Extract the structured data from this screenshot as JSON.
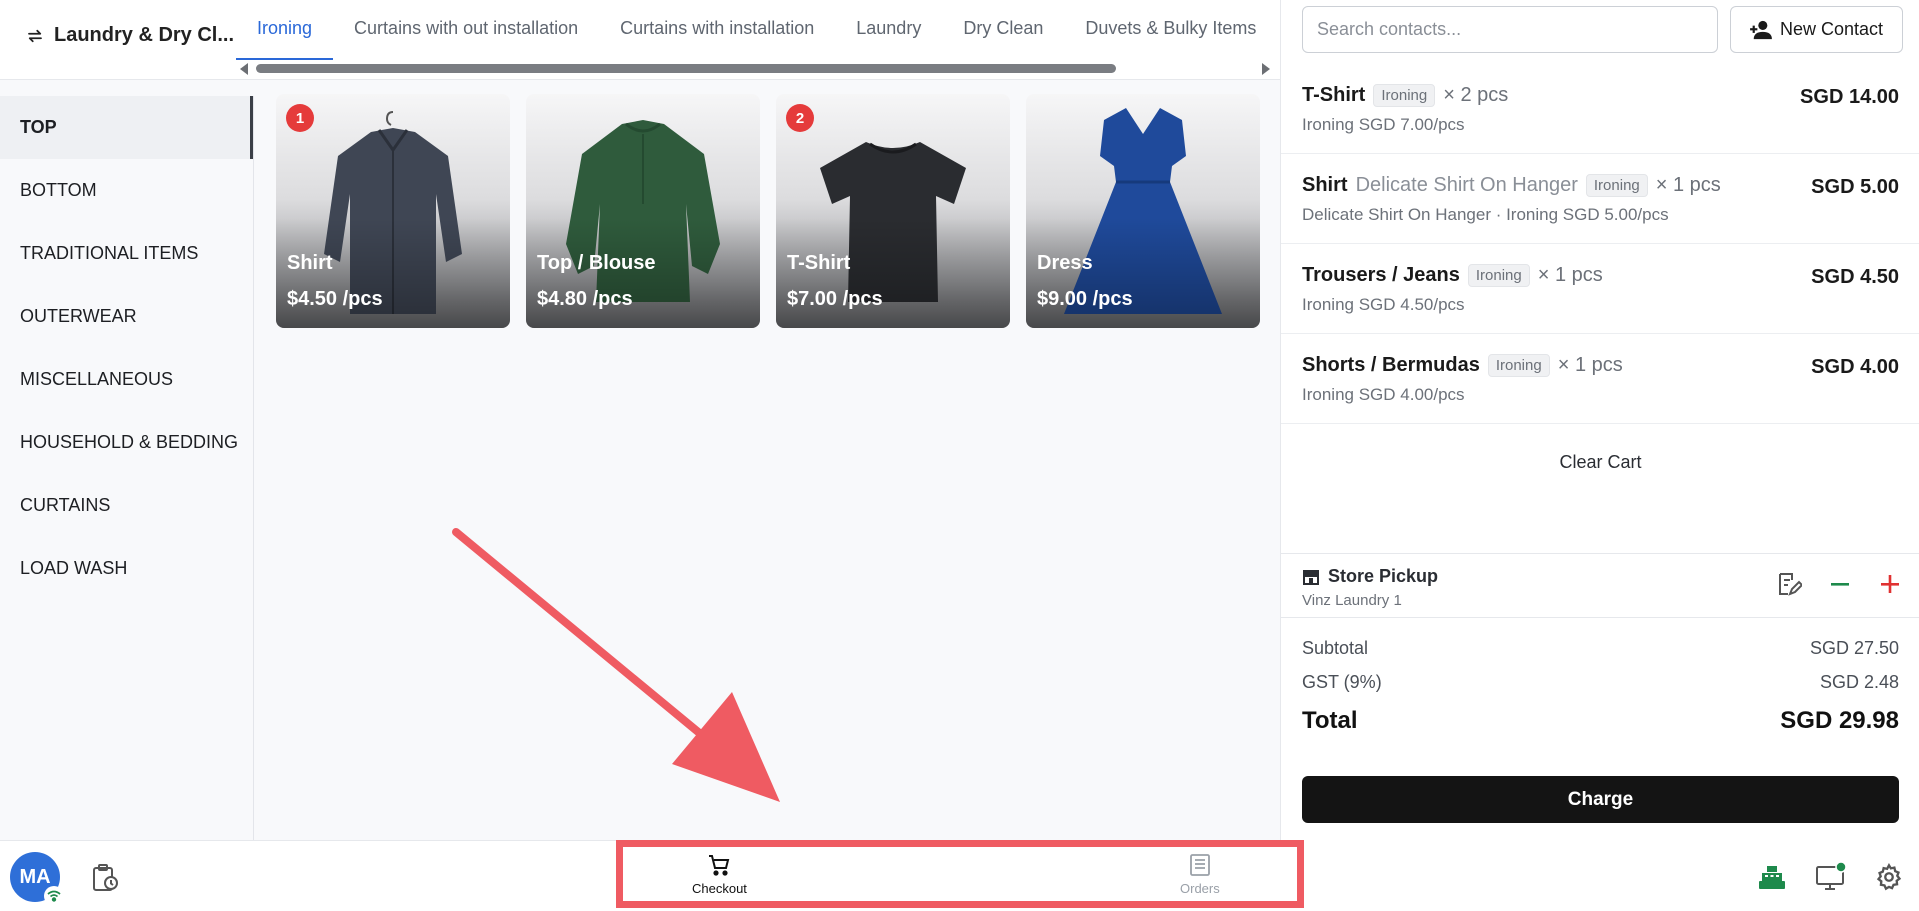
{
  "store": {
    "name": "Laundry & Dry Cl..."
  },
  "tabs": [
    "Ironing",
    "Curtains with out installation",
    "Curtains with installation",
    "Laundry",
    "Dry Clean",
    "Duvets & Bulky Items"
  ],
  "categories": [
    "TOP",
    "BOTTOM",
    "TRADITIONAL ITEMS",
    "OUTERWEAR",
    "MISCELLANEOUS",
    "HOUSEHOLD & BEDDING",
    "CURTAINS",
    "LOAD WASH"
  ],
  "products": [
    {
      "name": "Shirt",
      "price": "$4.50 /pcs",
      "badge": "1",
      "color": "#3f4654"
    },
    {
      "name": "Top / Blouse",
      "price": "$4.80 /pcs",
      "badge": "",
      "color": "#2f5b3c"
    },
    {
      "name": "T-Shirt",
      "price": "$7.00 /pcs",
      "badge": "2",
      "color": "#2a2c30"
    },
    {
      "name": "Dress",
      "price": "$9.00 /pcs",
      "badge": "",
      "color": "#1f4a9b"
    }
  ],
  "search": {
    "placeholder": "Search contacts..."
  },
  "new_contact_label": "New Contact",
  "cart": [
    {
      "name": "T-Shirt",
      "variant": "",
      "tag": "Ironing",
      "qty": "× 2 pcs",
      "sub": "Ironing SGD 7.00/pcs",
      "amount": "SGD 14.00"
    },
    {
      "name": "Shirt",
      "variant": "Delicate Shirt On Hanger",
      "tag": "Ironing",
      "qty": "× 1 pcs",
      "sub": "Delicate Shirt On Hanger · Ironing SGD 5.00/pcs",
      "amount": "SGD 5.00"
    },
    {
      "name": "Trousers / Jeans",
      "variant": "",
      "tag": "Ironing",
      "qty": "× 1 pcs",
      "sub": "Ironing SGD 4.50/pcs",
      "amount": "SGD 4.50"
    },
    {
      "name": "Shorts / Bermudas",
      "variant": "",
      "tag": "Ironing",
      "qty": "× 1 pcs",
      "sub": "Ironing SGD 4.00/pcs",
      "amount": "SGD 4.00"
    }
  ],
  "clear_cart_label": "Clear Cart",
  "pickup": {
    "title": "Store Pickup",
    "location": "Vinz Laundry 1"
  },
  "totals": {
    "subtotal_label": "Subtotal",
    "subtotal": "SGD 27.50",
    "gst_label": "GST (9%)",
    "gst": "SGD 2.48",
    "total_label": "Total",
    "total": "SGD 29.98"
  },
  "charge_label": "Charge",
  "user": {
    "initials": "MA"
  },
  "nav": {
    "checkout": "Checkout",
    "orders": "Orders"
  },
  "colors": {
    "accent": "#2a68d8",
    "badge": "#e53b3b",
    "annotation": "#ef5b62",
    "cash_green": "#1e8a4c"
  }
}
